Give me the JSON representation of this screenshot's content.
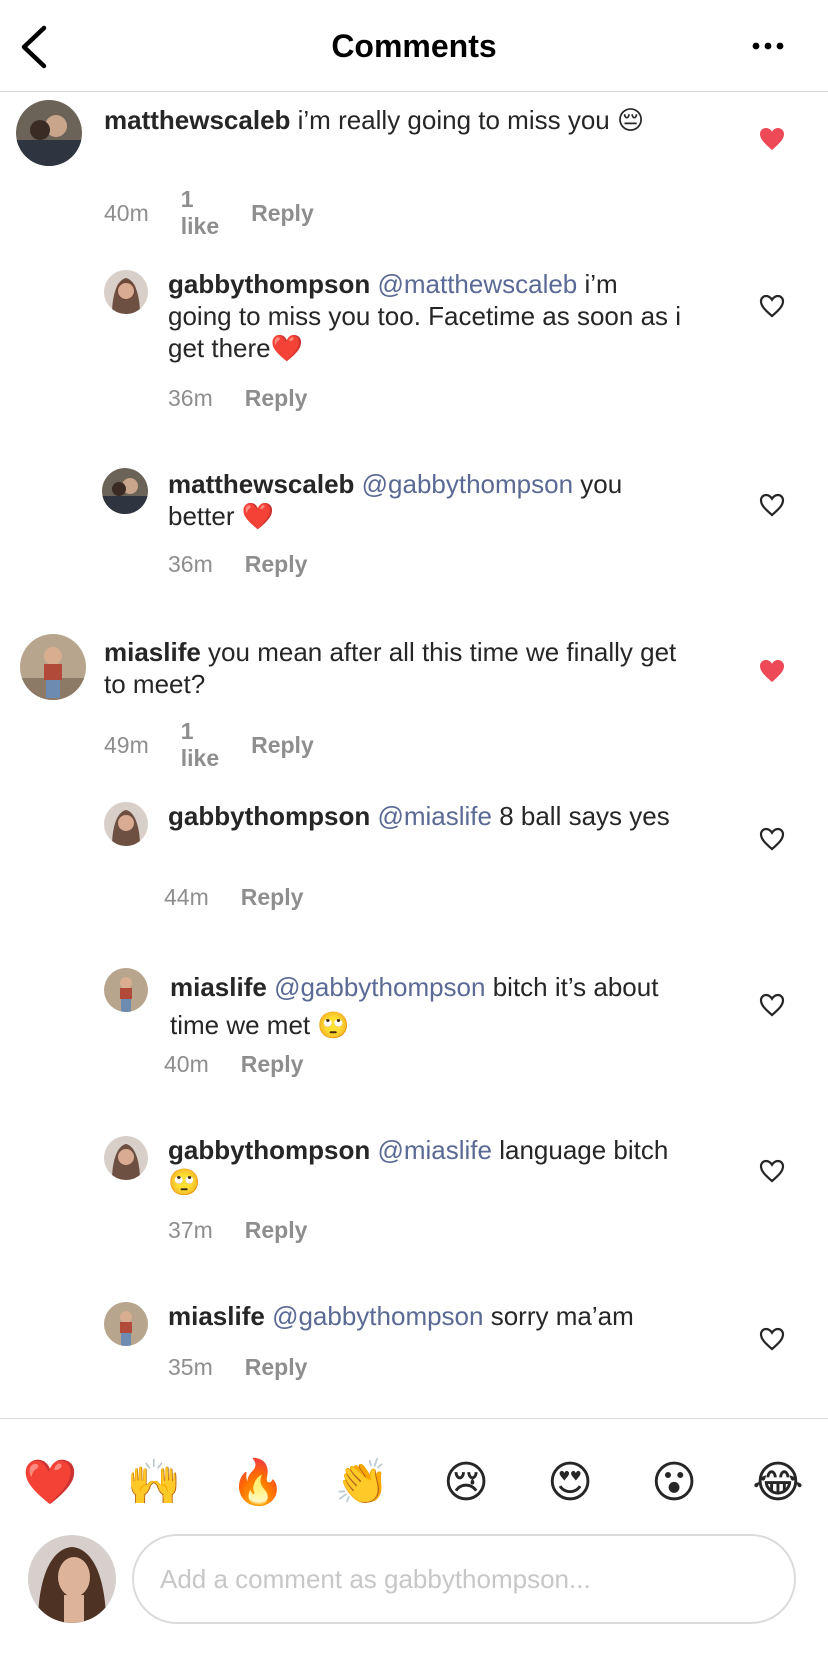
{
  "header": {
    "title": "Comments"
  },
  "comments": [
    {
      "user": "matthewscaleb",
      "mention": "",
      "text": " i’m really going to miss you",
      "emoji": "😔",
      "time": "40m",
      "likes": "1 like",
      "reply": "Reply",
      "liked": true
    },
    {
      "user": "gabbythompson",
      "mention": "@matthewscaleb",
      "text": " i’m going to miss you too. Facetime as soon as i get there",
      "emoji": "❤️",
      "time": "36m",
      "likes": "",
      "reply": "Reply",
      "liked": false
    },
    {
      "user": "matthewscaleb",
      "mention": "@gabbythompson",
      "text": " you better",
      "emoji": "❤️",
      "time": "36m",
      "likes": "",
      "reply": "Reply",
      "liked": false
    },
    {
      "user": "miaslife",
      "mention": "",
      "text": " you mean after all this time we finally get to meet?",
      "emoji": "",
      "time": "49m",
      "likes": "1 like",
      "reply": "Reply",
      "liked": true
    },
    {
      "user": "gabbythompson",
      "mention": "@miaslife",
      "text": " 8 ball says yes",
      "emoji": "",
      "time": "44m",
      "likes": "",
      "reply": "Reply",
      "liked": false
    },
    {
      "user": "miaslife",
      "mention": "@gabbythompson",
      "text": " bitch it’s about time we met",
      "emoji": "🙄",
      "time": "40m",
      "likes": "",
      "reply": "Reply",
      "liked": false
    },
    {
      "user": "gabbythompson",
      "mention": "@miaslife",
      "text": " language bitch",
      "emoji": "🙄",
      "time": "37m",
      "likes": "",
      "reply": "Reply",
      "liked": false
    },
    {
      "user": "miaslife",
      "mention": "@gabbythompson",
      "text": " sorry ma’am",
      "emoji": "",
      "time": "35m",
      "likes": "",
      "reply": "Reply",
      "liked": false
    }
  ],
  "emoji_bar": [
    "❤️",
    "🙌",
    "🔥",
    "👏",
    "😢",
    "😍",
    "😮",
    "😂"
  ],
  "input": {
    "placeholder": "Add a comment as gabbythompson..."
  },
  "colors": {
    "like_red": "#ed4956",
    "mention_blue": "#5b6a94",
    "meta_gray": "#8e8e8e",
    "divider": "#dbdbdb"
  },
  "icons": {
    "back": "chevron-left-icon",
    "more": "more-horizontal-icon",
    "heart_filled": "heart-filled-icon",
    "heart_outline": "heart-outline-icon"
  }
}
